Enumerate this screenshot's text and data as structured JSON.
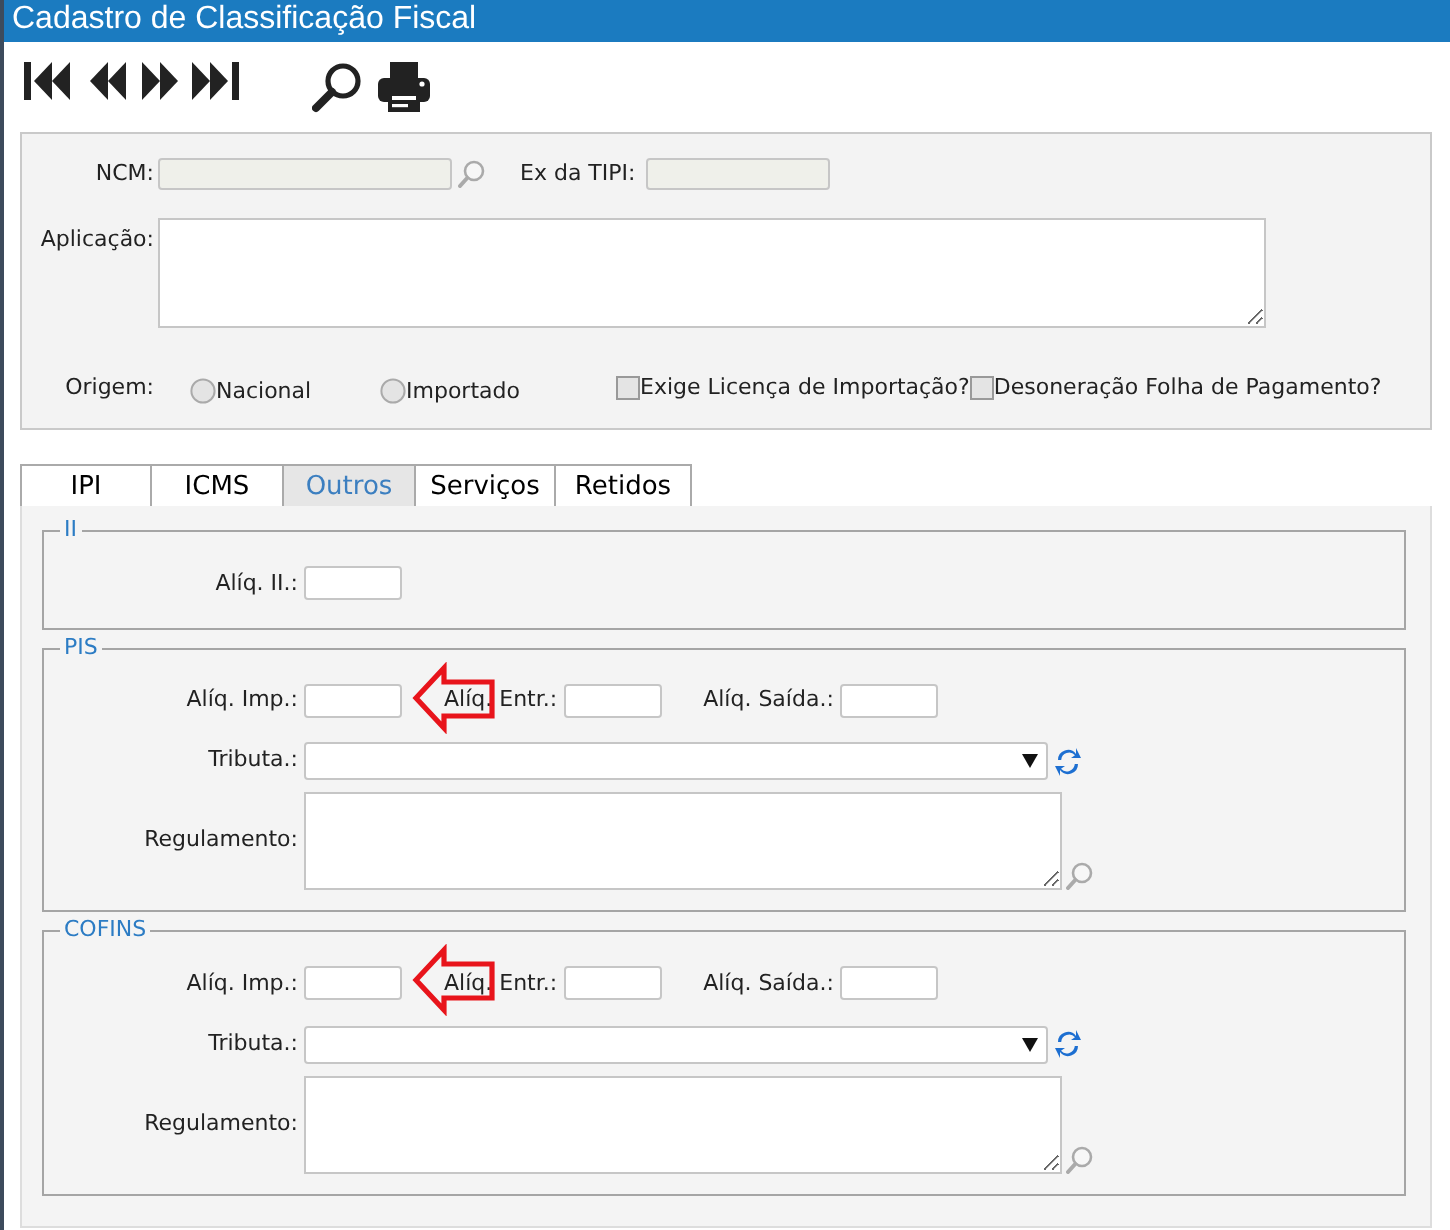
{
  "window": {
    "title": "Cadastro de Classificação Fiscal"
  },
  "toolbar": [
    {
      "kind": "first"
    },
    {
      "kind": "previous"
    },
    {
      "kind": "next"
    },
    {
      "kind": "last"
    },
    {
      "kind": "search"
    },
    {
      "kind": "print"
    }
  ],
  "header": {
    "ncm": {
      "label": "NCM:"
    },
    "ex_tipi": {
      "label": "Ex da TIPI:"
    },
    "aplicacao": {
      "label": "Aplicação:"
    },
    "origem": {
      "label": "Origem:",
      "options": [
        {
          "label": "Nacional",
          "selected": false
        },
        {
          "label": "Importado",
          "selected": false
        }
      ]
    },
    "checkboxes": [
      {
        "label": "Exige Licença de Importação?",
        "checked": false
      },
      {
        "label": "Desoneração Folha de Pagamento?",
        "checked": false
      }
    ]
  },
  "tabs": [
    {
      "label": "IPI",
      "selected": false
    },
    {
      "label": "ICMS",
      "selected": false
    },
    {
      "label": "Outros",
      "selected": true
    },
    {
      "label": "Serviços",
      "selected": false
    },
    {
      "label": "Retidos",
      "selected": false
    }
  ],
  "sections": [
    {
      "legend": "II",
      "rate_fields": [
        {
          "label": "Alíq. II.:"
        }
      ]
    },
    {
      "legend": "PIS",
      "rate_fields": [
        {
          "label": "Alíq. Imp.:"
        },
        {
          "label": "Alíq. Entr.:"
        },
        {
          "label": "Alíq. Saída.:"
        }
      ],
      "callout_arrow": true,
      "tributa": {
        "label": "Tributa.:"
      },
      "regulamento": {
        "label": "Regulamento:"
      }
    },
    {
      "legend": "COFINS",
      "rate_fields": [
        {
          "label": "Alíq. Imp.:"
        },
        {
          "label": "Alíq. Entr.:"
        },
        {
          "label": "Alíq. Saída.:"
        }
      ],
      "callout_arrow": true,
      "tributa": {
        "label": "Tributa.:"
      },
      "regulamento": {
        "label": "Regulamento:"
      }
    }
  ]
}
